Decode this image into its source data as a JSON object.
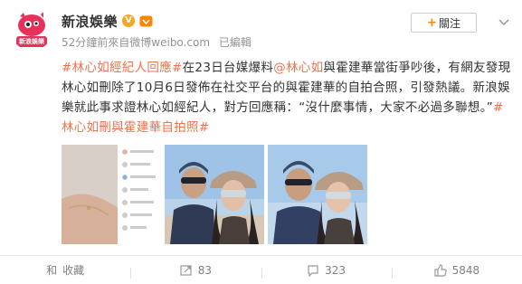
{
  "header": {
    "author_name": "新浪娛樂",
    "verified_mark": "V",
    "avatar_logo_text": "新浪娛樂",
    "time": "52分鐘前",
    "source": "來自微博weibo.com",
    "edited": "已編輯",
    "follow_label": "+關注",
    "follow_plus": "+",
    "follow_text": "關注"
  },
  "post": {
    "hashtag_lead": "#林心如經紀人回應#",
    "segment1": "在23日台媒爆料",
    "mention": "@林心如",
    "segment2": "與霍建華當街爭吵後，有網友發現林心如刪除了10月6日發佈在社交平台的與霍建華的自拍合照，引發熱議。新浪娛樂就此事求證林心如經紀人，對方回應稱：“沒什麼事情，大家不必過多聯想。”",
    "hashtag_tail": "#林心如刪與霍建華自拍照#"
  },
  "images": [
    {
      "name": "hand-bracelet-screenshot"
    },
    {
      "name": "couple-selfie-1"
    },
    {
      "name": "couple-selfie-2"
    }
  ],
  "footer": {
    "favorite_label": "收藏",
    "repost_count": "83",
    "comment_count": "323",
    "like_count": "5848"
  },
  "colors": {
    "accent_orange": "#ff8200",
    "hashtag": "#eb7350",
    "meta_gray": "#939393"
  }
}
